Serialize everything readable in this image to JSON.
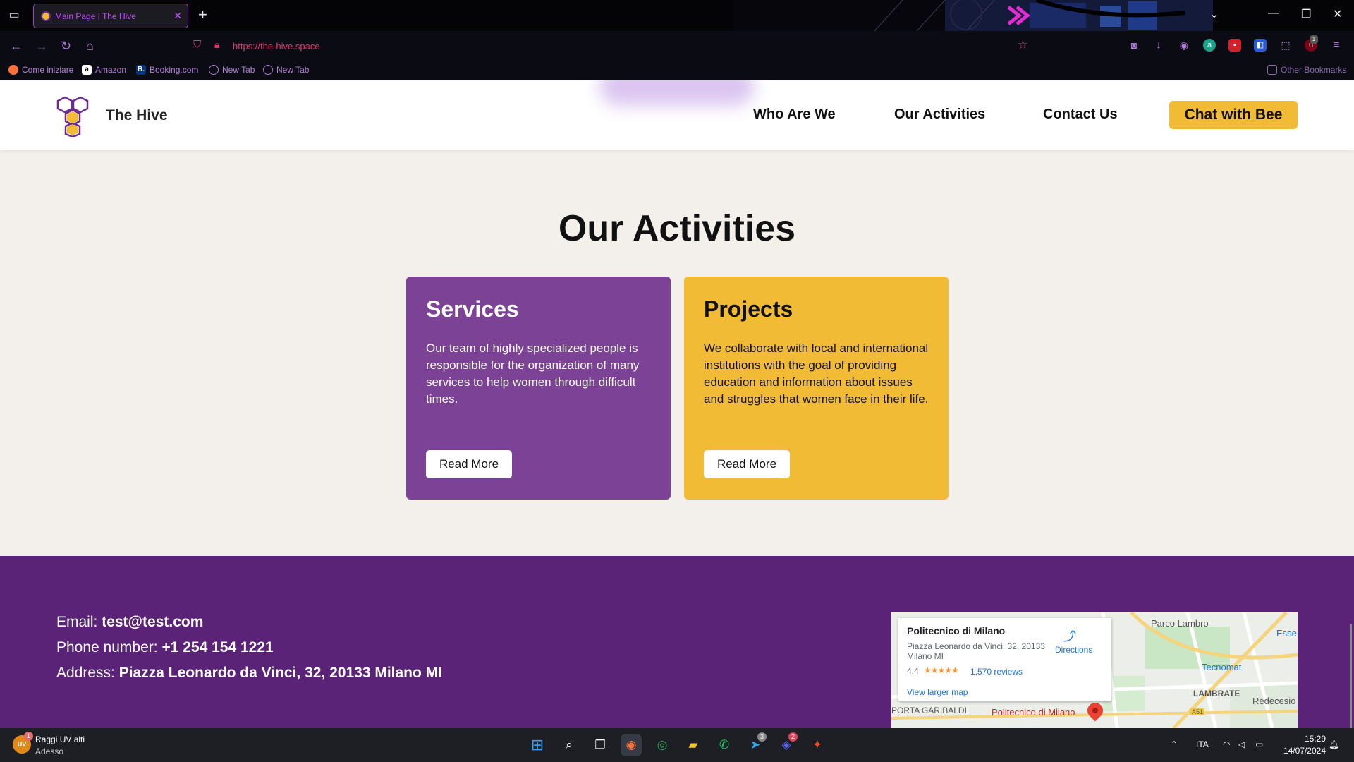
{
  "browser": {
    "tab_title": "Main Page | The Hive",
    "url": "https://the-hive.space",
    "bookmarks": [
      "Come iniziare",
      "Amazon",
      "Booking.com",
      "New Tab",
      "New Tab"
    ],
    "other_bookmarks": "Other Bookmarks",
    "ext_badge": "1"
  },
  "header": {
    "brand": "The Hive",
    "nav": [
      "Who Are We",
      "Our Activities",
      "Contact Us"
    ],
    "cta": "Chat with Bee"
  },
  "activities": {
    "title": "Our Activities",
    "cards": [
      {
        "title": "Services",
        "text": "Our team of highly specialized people is responsible for the organization of many services to help women through difficult times.",
        "button": "Read More"
      },
      {
        "title": "Projects",
        "text": "We collaborate with local and international institutions with the goal of providing education and information about issues and struggles that women face in their life.",
        "button": "Read More"
      }
    ]
  },
  "footer": {
    "email_label": "Email:",
    "email": "test@test.com",
    "phone_label": "Phone number:",
    "phone": "+1 254 154 1221",
    "address_label": "Address:",
    "address": "Piazza Leonardo da Vinci, 32, 20133 Milano MI"
  },
  "map": {
    "place": "Politecnico di Milano",
    "address": "Piazza Leonardo da Vinci, 32, 20133 Milano MI",
    "rating": "4.4",
    "stars": "★★★★★",
    "reviews": "1,570 reviews",
    "directions": "Directions",
    "view_larger": "View larger map",
    "labels": [
      "Parco Lambro",
      "Esse",
      "Tecnomat",
      "LAMBRATE",
      "Redecesio",
      "PORTA GARIBALDI",
      "Politecnico di Milano",
      "A51"
    ]
  },
  "taskbar": {
    "weather_icon_text": "UV",
    "weather_badge": "1",
    "weather_title": "Raggi UV alti",
    "weather_sub": "Adesso",
    "telegram_badge": "3",
    "discord_badge": "2",
    "language": "ITA",
    "time": "15:29",
    "date": "14/07/2024"
  },
  "colors": {
    "purple": "#7b4296",
    "yellow": "#f2bb36",
    "footer": "#5a2377",
    "background": "#f3f0eb"
  }
}
